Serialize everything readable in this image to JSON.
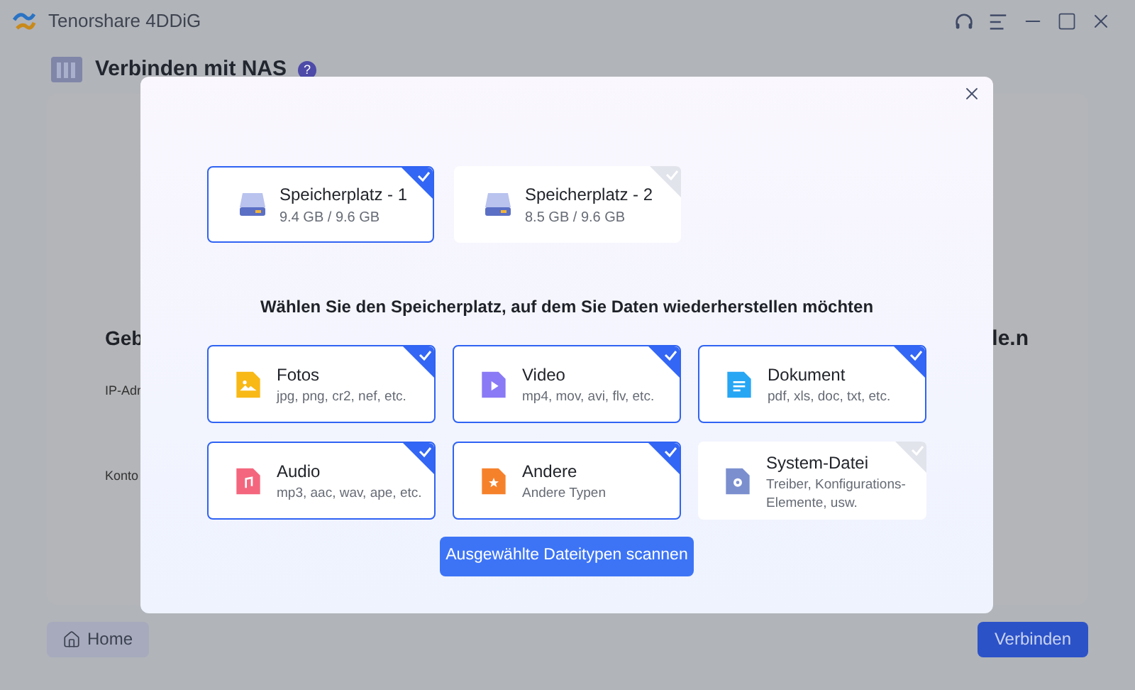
{
  "app": {
    "title": "Tenorshare 4DDiG",
    "header": "Verbinden mit NAS",
    "help_badge": "?"
  },
  "background_texts": {
    "heading_start": "Geb",
    "heading_end": "le.n",
    "ip_label": "IP-Adr",
    "account_label": "Konto"
  },
  "footer": {
    "home": "Home",
    "connect": "Verbinden"
  },
  "dialog": {
    "storages": [
      {
        "name": "Speicherplatz - 1",
        "usage": "9.4 GB / 9.6 GB",
        "selected": true
      },
      {
        "name": "Speicherplatz - 2",
        "usage": "8.5 GB / 9.6 GB",
        "selected": false
      }
    ],
    "prompt": "Wählen Sie den Speicherplatz, auf dem Sie Daten wiederherstellen möchten",
    "file_types": [
      {
        "kind": "image",
        "name": "Fotos",
        "extensions": "jpg, png, cr2, nef, etc.",
        "checked": true
      },
      {
        "kind": "video",
        "name": "Video",
        "extensions": "mp4, mov, avi, flv, etc.",
        "checked": true
      },
      {
        "kind": "document",
        "name": "Dokument",
        "extensions": "pdf, xls, doc, txt, etc.",
        "checked": true
      },
      {
        "kind": "audio",
        "name": "Audio",
        "extensions": "mp3, aac, wav, ape, etc.",
        "checked": true
      },
      {
        "kind": "other",
        "name": "Andere",
        "extensions": "Andere Typen",
        "checked": true
      },
      {
        "kind": "system",
        "name": "System-Datei",
        "extensions": "Treiber, Konfigurations-Elemente, usw.",
        "checked": false
      }
    ],
    "scan_button": "Ausgewählte Dateitypen scannen"
  }
}
